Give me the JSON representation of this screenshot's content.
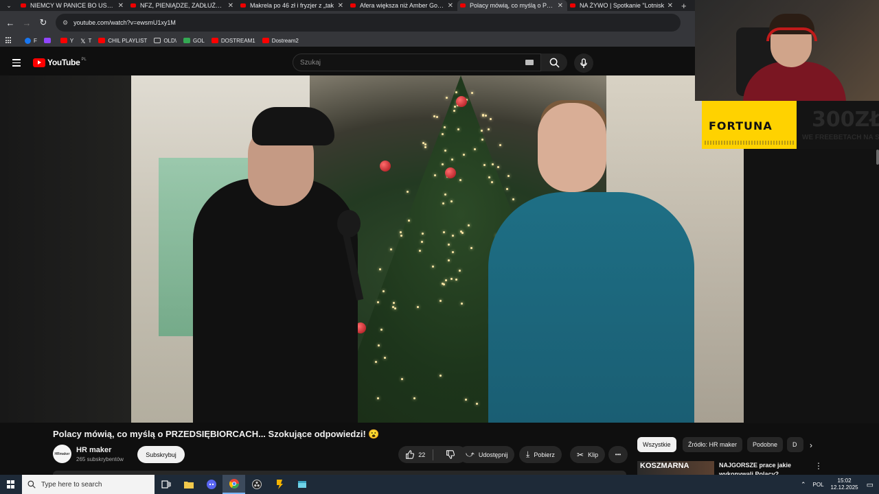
{
  "browser": {
    "tabs": [
      {
        "title": "NIEMCY W PANICE BO USA STA",
        "active": false
      },
      {
        "title": "NFZ, PIENIĄDZE, ZADŁUŻENIE :",
        "active": false
      },
      {
        "title": "Makrela po 46 zł i fryzjer z „tak",
        "active": false
      },
      {
        "title": "Afera większa niż Amber Gold?",
        "active": false
      },
      {
        "title": "Polacy mówią, co myślą o PRZE",
        "active": true
      },
      {
        "title": "NA ŻYWO | Spotkanie \"Lotnisk",
        "active": false
      }
    ],
    "url": "youtube.com/watch?v=ewsmU1xy1M",
    "bookmarks": [
      {
        "label": "F",
        "color": "#1877f2"
      },
      {
        "label": "",
        "color": "#9146ff"
      },
      {
        "label": "Y",
        "color": "#ff0000"
      },
      {
        "label": "T",
        "color": "#000000"
      },
      {
        "label": "CHIL PLAYLIST",
        "color": "#ff0000"
      },
      {
        "label": "OLD\\",
        "color": "folder"
      },
      {
        "label": "GOL",
        "color": "#34a853"
      },
      {
        "label": "DOSTREAM1",
        "color": "#ff0000"
      },
      {
        "label": "Dostream2",
        "color": "#ff0000"
      }
    ]
  },
  "youtube": {
    "logo_text": "YouTube",
    "region": "PL",
    "search_placeholder": "Szukaj"
  },
  "video": {
    "title": "Polacy mówią, co myślą o PRZEDSIĘBIORCACH... Szokujące odpowiedzi! 😮",
    "channel": "HR maker",
    "channel_avatar_text": "HRmaker",
    "subscribers": "265 subskrybentów",
    "subscribe_label": "Subskrybuj",
    "likes": "22",
    "share_label": "Udostępnij",
    "download_label": "Pobierz",
    "clip_label": "Klip",
    "more_label": "•••"
  },
  "overlay": {
    "sponsor": "FORTUNA",
    "promo_amount": "300ZŁ",
    "promo_text": "WE FREEBETACH NA STA"
  },
  "chips": [
    "Wszystkie",
    "Źródło: HR maker",
    "Podobne",
    "D"
  ],
  "recommended": {
    "thumb_label": "KOSZMARNA",
    "title": "NAJGORSZE prace jakie wykonywali Polacy?"
  },
  "taskbar": {
    "search_placeholder": "Type here to search",
    "lang": "POL",
    "time": "15:02",
    "date": "12.12.2025"
  }
}
